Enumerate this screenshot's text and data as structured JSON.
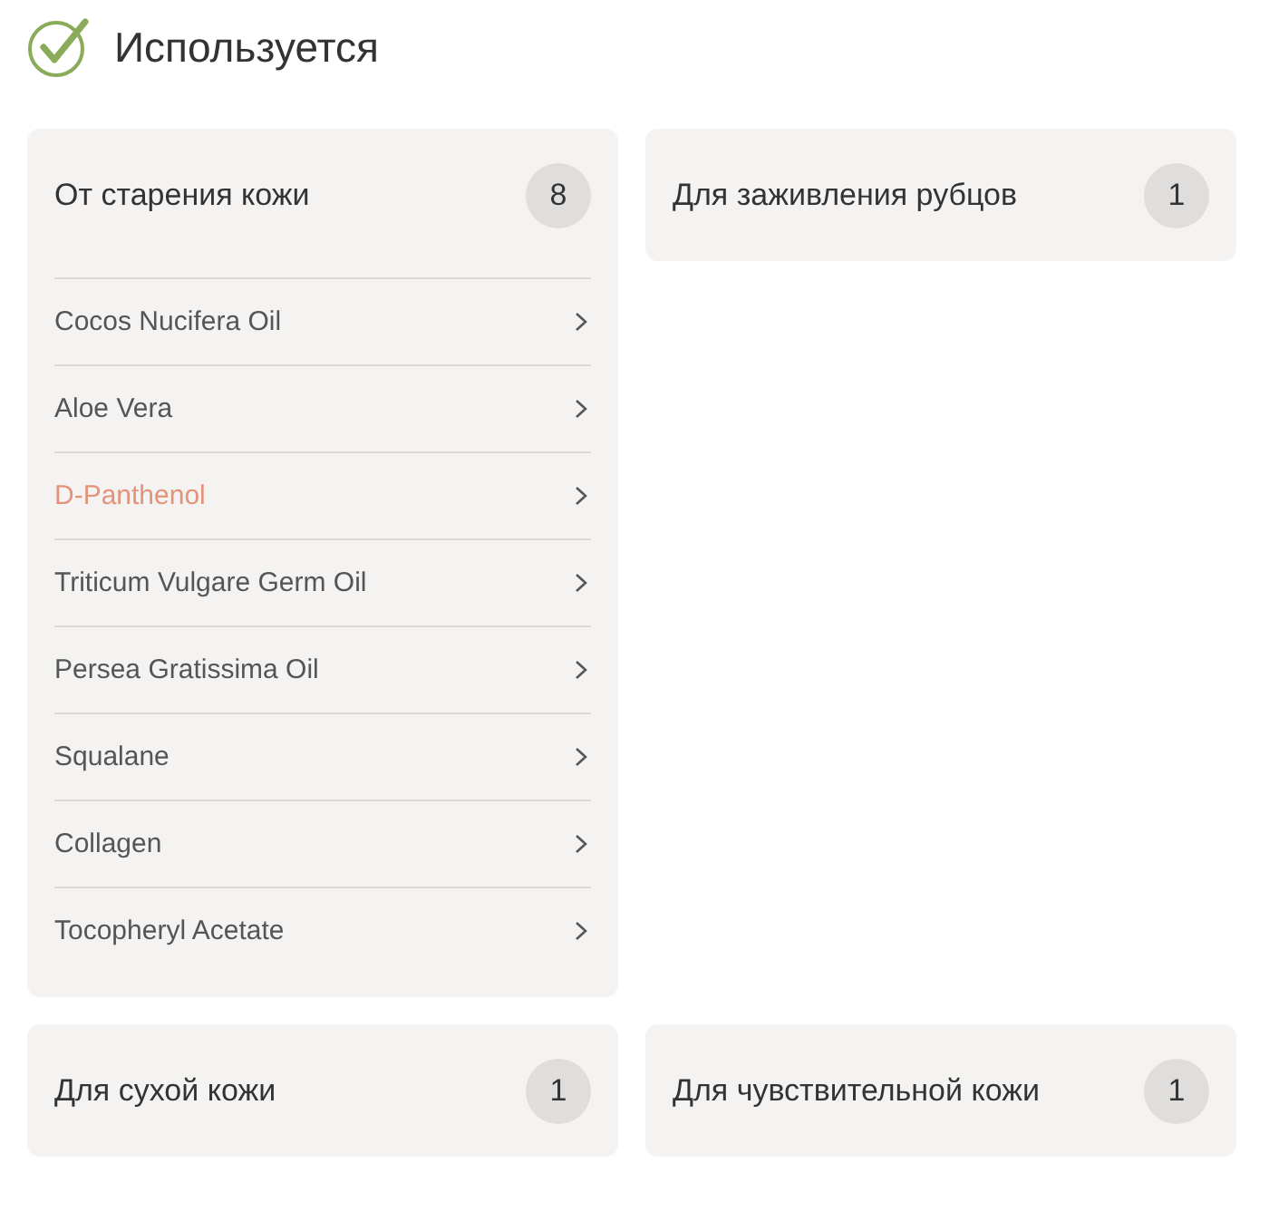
{
  "header": {
    "title": "Используется"
  },
  "cards": [
    {
      "title": "От старения кожи",
      "count": "8",
      "items": [
        {
          "label": "Cocos Nucifera Oil",
          "selected": false
        },
        {
          "label": "Aloe Vera",
          "selected": false
        },
        {
          "label": "D-Panthenol",
          "selected": true
        },
        {
          "label": "Triticum Vulgare Germ Oil",
          "selected": false
        },
        {
          "label": "Persea Gratissima Oil",
          "selected": false
        },
        {
          "label": "Squalane",
          "selected": false
        },
        {
          "label": "Collagen",
          "selected": false
        },
        {
          "label": "Tocopheryl Acetate",
          "selected": false
        }
      ]
    },
    {
      "title": "Для заживления рубцов",
      "count": "1"
    },
    {
      "title": "Для сухой кожи",
      "count": "1"
    },
    {
      "title": "Для чувствительной кожи",
      "count": "1"
    }
  ]
}
